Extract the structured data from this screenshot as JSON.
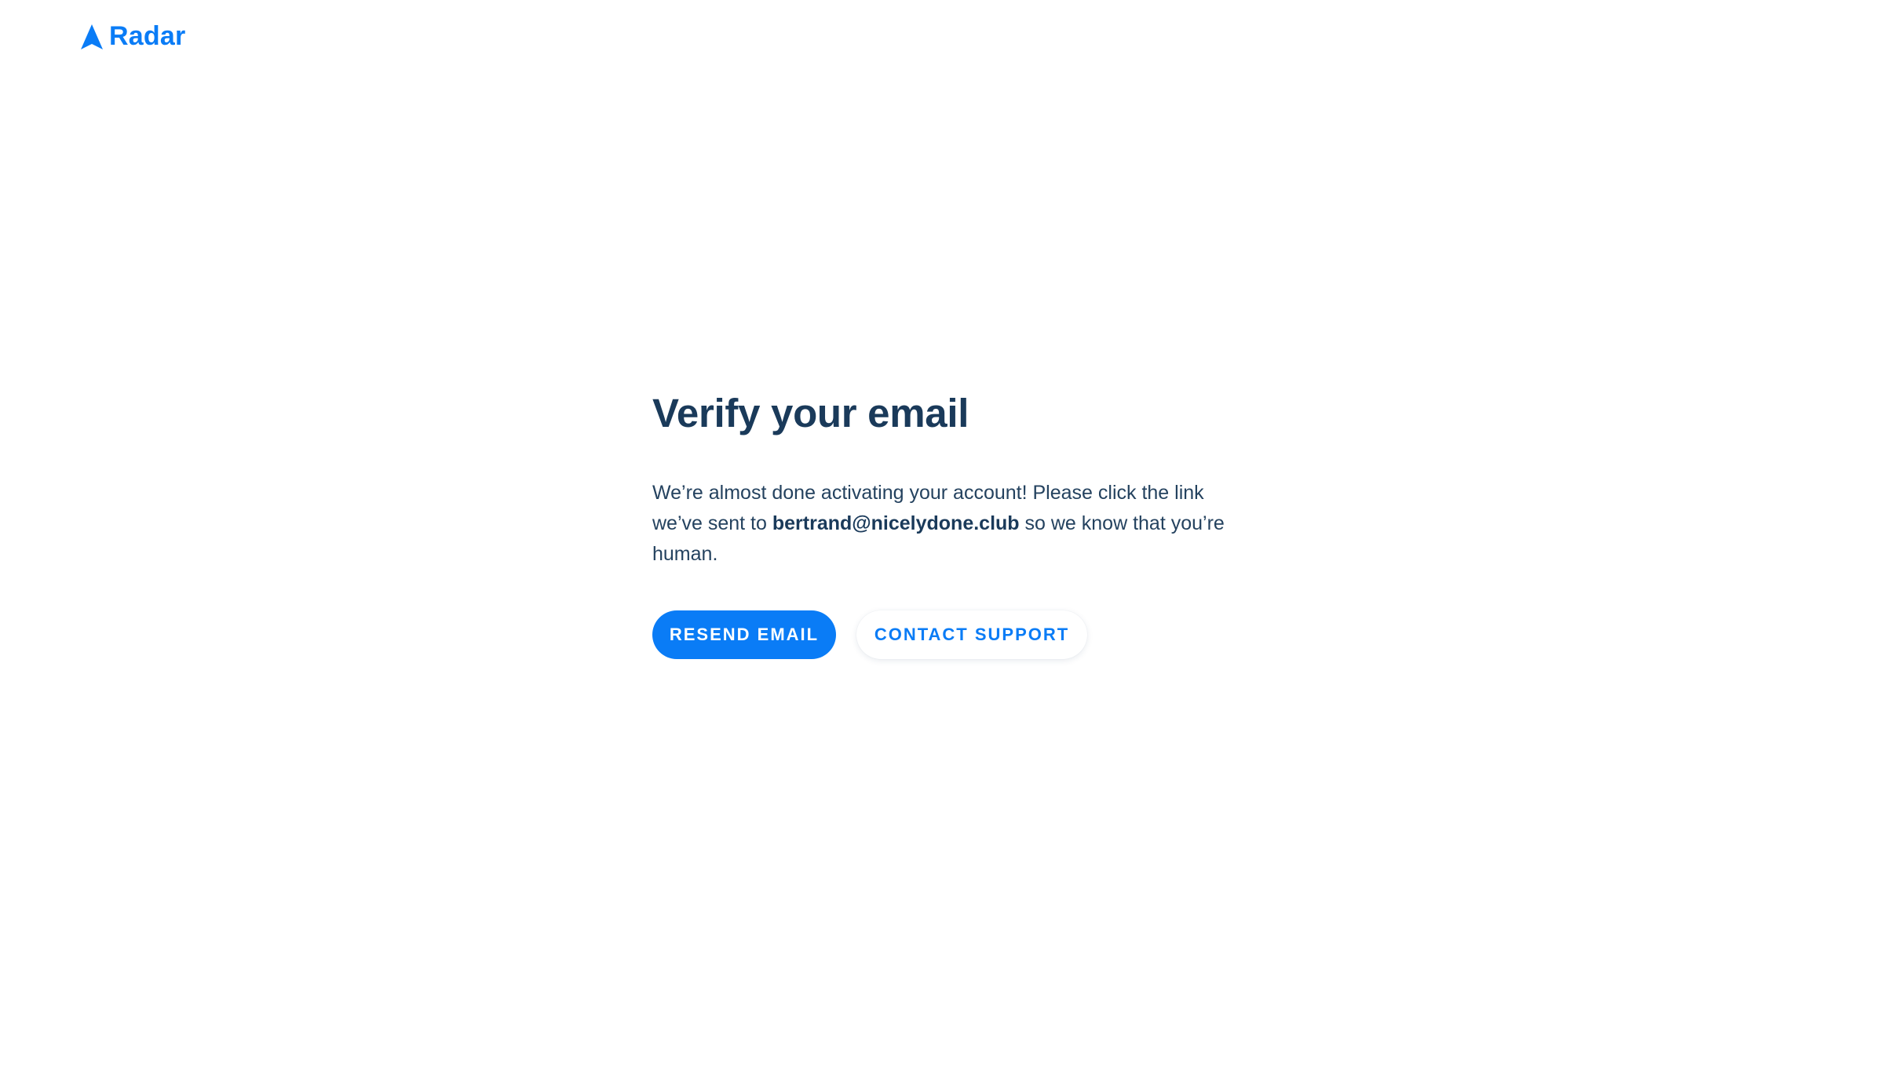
{
  "brand": {
    "name": "Radar",
    "logo_icon": "arrow-navigation-icon",
    "color": "#0a7cf6"
  },
  "main": {
    "title": "Verify your email",
    "message_before": "We’re almost done activating your account! Please click the link we’ve sent to ",
    "email": "bertrand@nicelydone.club",
    "message_after": " so we know that you’re human."
  },
  "actions": {
    "resend_label": "RESEND EMAIL",
    "contact_label": "CONTACT SUPPORT"
  },
  "colors": {
    "accent": "#0a7cf6",
    "heading": "#1a3a5a",
    "body_text": "#24425f",
    "background": "#ffffff"
  }
}
